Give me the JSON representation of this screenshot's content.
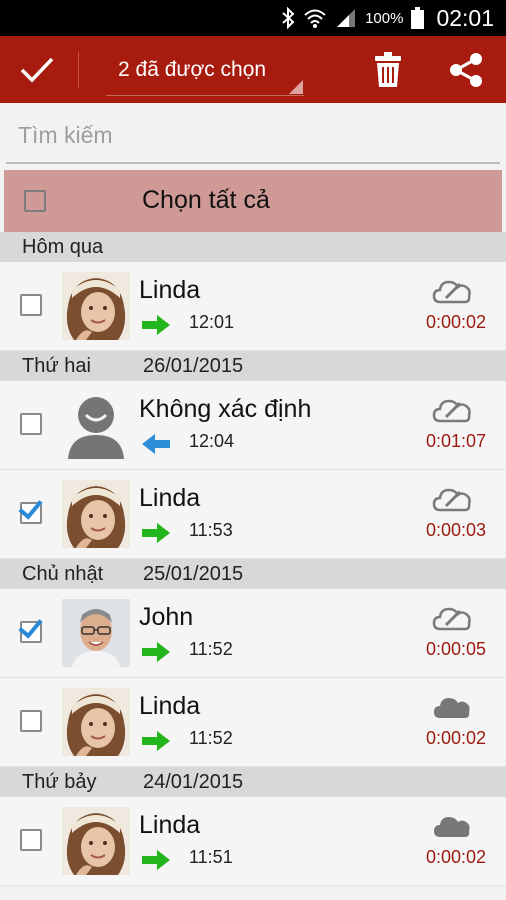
{
  "status": {
    "battery": "100%",
    "clock": "02:01"
  },
  "toolbar": {
    "selected_label": "2 đã được chọn"
  },
  "search": {
    "placeholder": "Tìm kiếm"
  },
  "select_all": {
    "label": "Chọn tất cả"
  },
  "colors": {
    "accent": "#a81b0f",
    "duration": "#9b1a10",
    "outgoing": "#22b51c",
    "incoming": "#2d8ed8"
  },
  "groups": [
    {
      "day": "Hôm qua",
      "date": "",
      "items": [
        {
          "name": "Linda",
          "direction": "outgoing",
          "time": "12:01",
          "duration": "0:00:02",
          "checked": false,
          "avatar": "linda",
          "cloud": "cloud-crossed-icon"
        }
      ]
    },
    {
      "day": "Thứ hai",
      "date": "26/01/2015",
      "items": [
        {
          "name": "Không xác định",
          "direction": "incoming",
          "time": "12:04",
          "duration": "0:01:07",
          "checked": false,
          "avatar": "unknown",
          "cloud": "cloud-crossed-icon"
        },
        {
          "name": "Linda",
          "direction": "outgoing",
          "time": "11:53",
          "duration": "0:00:03",
          "checked": true,
          "avatar": "linda",
          "cloud": "cloud-crossed-icon"
        }
      ]
    },
    {
      "day": "Chủ nhật",
      "date": "25/01/2015",
      "items": [
        {
          "name": "John",
          "direction": "outgoing",
          "time": "11:52",
          "duration": "0:00:05",
          "checked": true,
          "avatar": "john",
          "cloud": "cloud-crossed-icon"
        },
        {
          "name": "Linda",
          "direction": "outgoing",
          "time": "11:52",
          "duration": "0:00:02",
          "checked": false,
          "avatar": "linda",
          "cloud": "cloud-filled-icon"
        }
      ]
    },
    {
      "day": "Thứ bảy",
      "date": "24/01/2015",
      "items": [
        {
          "name": "Linda",
          "direction": "outgoing",
          "time": "11:51",
          "duration": "0:00:02",
          "checked": false,
          "avatar": "linda",
          "cloud": "cloud-filled-icon"
        }
      ]
    }
  ]
}
